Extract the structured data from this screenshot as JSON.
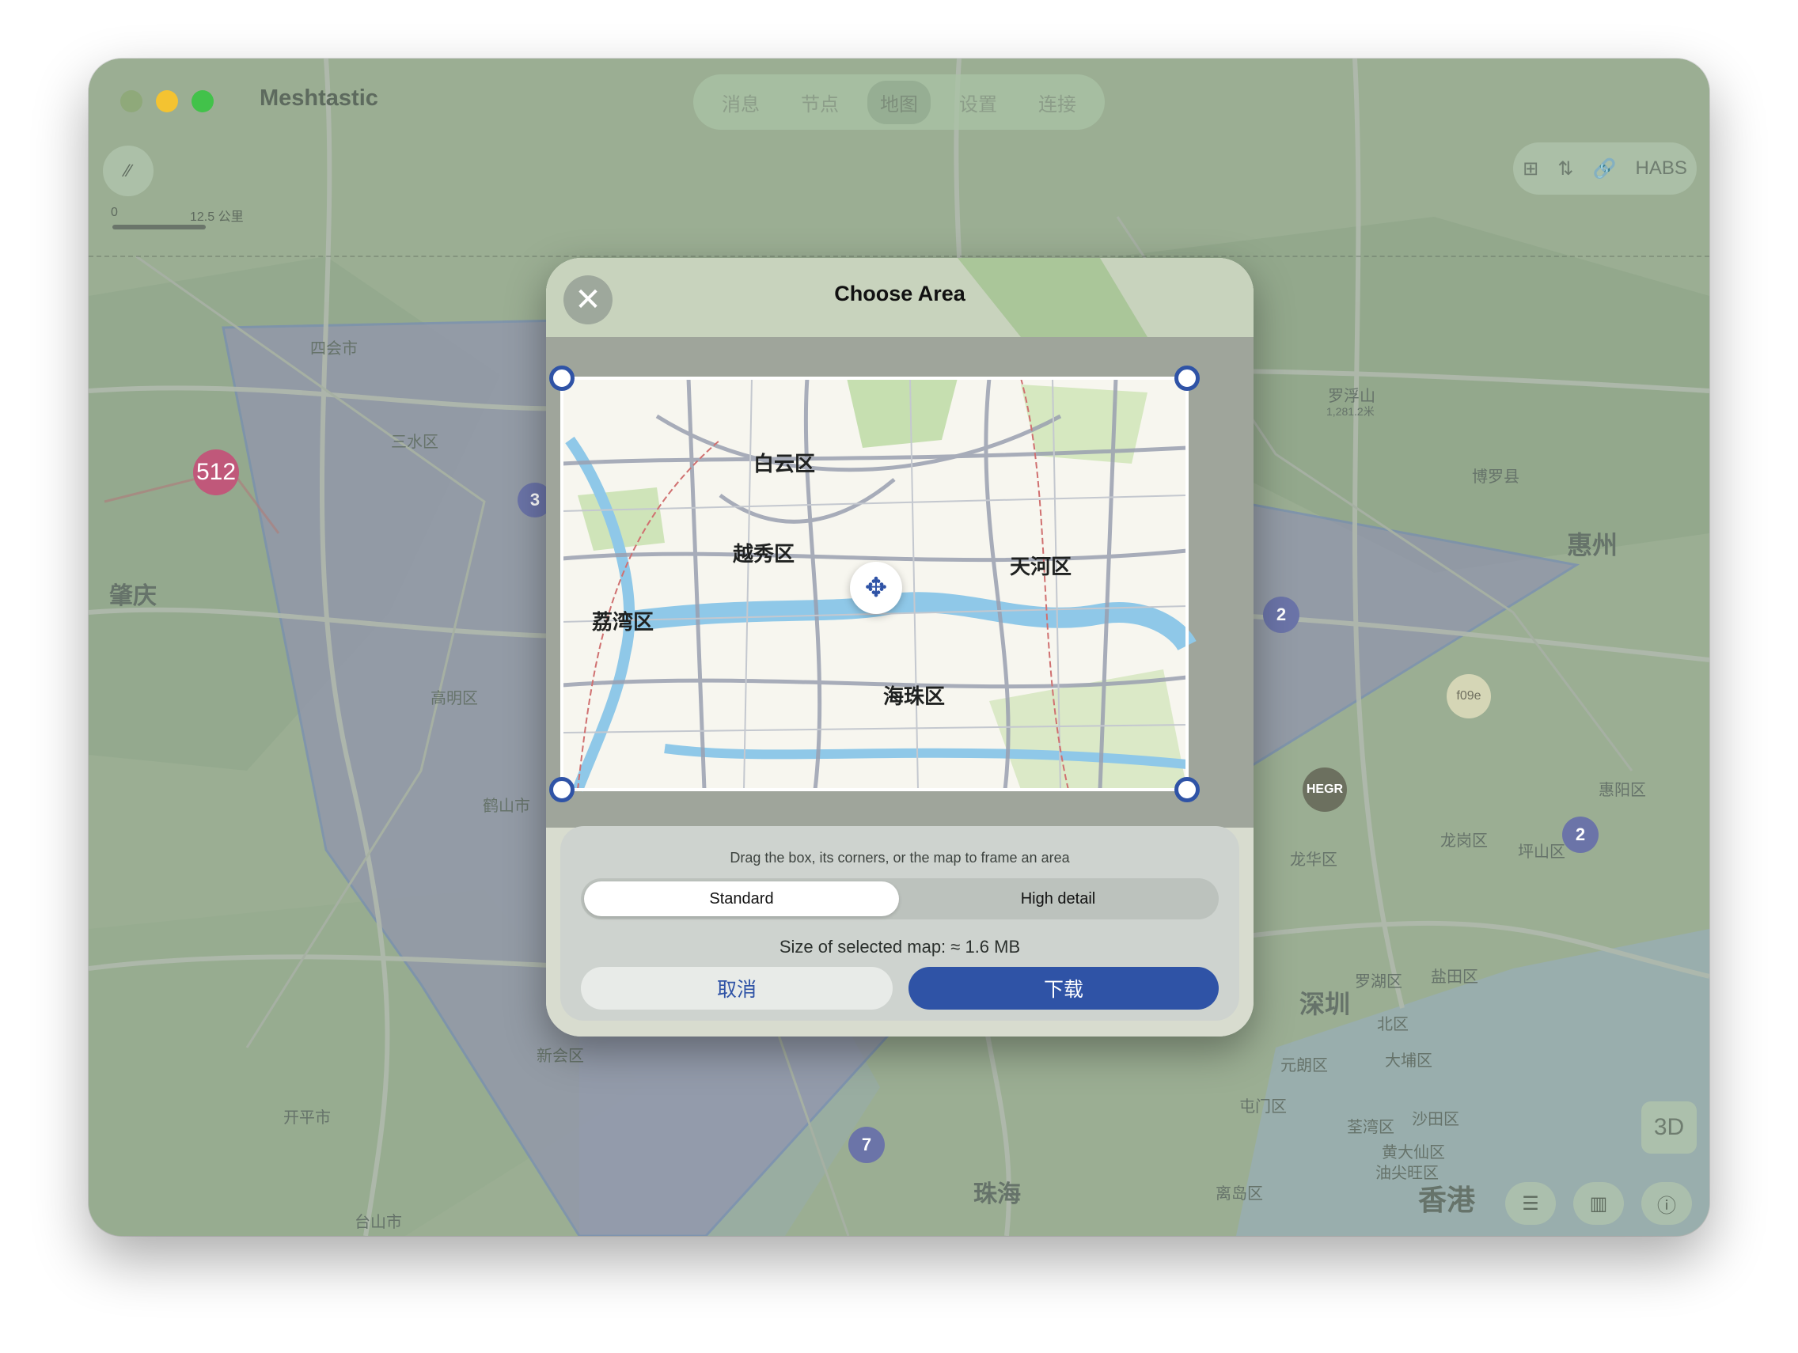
{
  "app": {
    "title": "Meshtastic"
  },
  "tabs": [
    {
      "label": "消息",
      "active": false
    },
    {
      "label": "节点",
      "active": false
    },
    {
      "label": "地图",
      "active": true
    },
    {
      "label": "设置",
      "active": false
    },
    {
      "label": "连接",
      "active": false
    }
  ],
  "scale": {
    "zero": "0",
    "distance": "12.5 公里"
  },
  "top_right": {
    "route_label": "HABS"
  },
  "map_labels": {
    "sihui": "四会市",
    "sanshui": "三水区",
    "zhaoqing": "肇庆",
    "gaoming": "高明区",
    "heshan": "鹤山市",
    "xinhui": "新会区",
    "kaiping": "开平市",
    "taishan": "台山市",
    "zhuhai": "珠海",
    "luofushan": "罗浮山",
    "luofushan_elev": "1,281.2米",
    "boluo": "博罗县",
    "huizhou": "惠州",
    "huiyang": "惠阳区",
    "longgang": "龙岗区",
    "pingshan": "坪山区",
    "longhua": "龙华区",
    "shenzhen": "深圳",
    "luohu": "罗湖区",
    "yantian": "盐田区",
    "beiqu": "北区",
    "yuanlang": "元朗区",
    "dapu": "大埔区",
    "tunmen": "屯门区",
    "quanwan": "荃湾区",
    "shatian": "沙田区",
    "huangdaxian": "黄大仙区",
    "youjianwang": "油尖旺区",
    "lidao": "离岛区",
    "hongkong": "香港"
  },
  "clusters": {
    "c512": "512",
    "c3": "3",
    "c2a": "2",
    "c2b": "2",
    "c7": "7",
    "hegr": "HEGR",
    "f09e": "f09e"
  },
  "controls": {
    "three_d": "3D"
  },
  "dialog": {
    "title": "Choose Area",
    "close_symbol": "✕",
    "districts": {
      "baiyun": "白云区",
      "yuexiu": "越秀区",
      "tianhe": "天河区",
      "liwan": "荔湾区",
      "haizhu": "海珠区"
    },
    "hint": "Drag the box, its corners, or the map to frame an area",
    "detail_options": [
      "Standard",
      "High detail"
    ],
    "selected_option": "Standard",
    "size_text": "Size of selected map: ≈ 1.6 MB",
    "cancel_label": "取消",
    "download_label": "下载"
  }
}
